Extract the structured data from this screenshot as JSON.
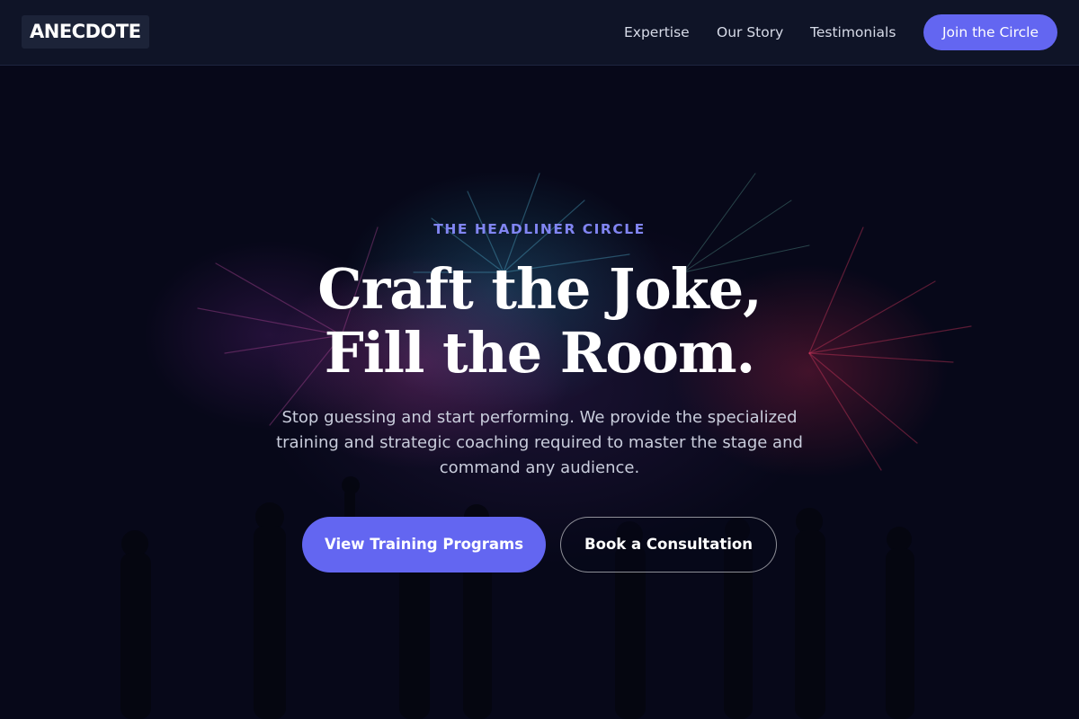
{
  "header": {
    "logo": "ANECDOTE",
    "nav": [
      {
        "label": "Expertise"
      },
      {
        "label": "Our Story"
      },
      {
        "label": "Testimonials"
      }
    ],
    "cta_label": "Join the Circle"
  },
  "hero": {
    "eyebrow": "THE HEADLINER CIRCLE",
    "headline_line1": "Craft the Joke,",
    "headline_line2": "Fill the Room.",
    "subtext": "Stop guessing and start performing. We provide the specialized training and strategic coaching required to master the stage and command any audience.",
    "primary_button": "View Training Programs",
    "secondary_button": "Book a Consultation"
  },
  "colors": {
    "accent": "#6366f1",
    "eyebrow": "#8185f2",
    "background": "#070819",
    "header_bg": "#0f1427"
  }
}
